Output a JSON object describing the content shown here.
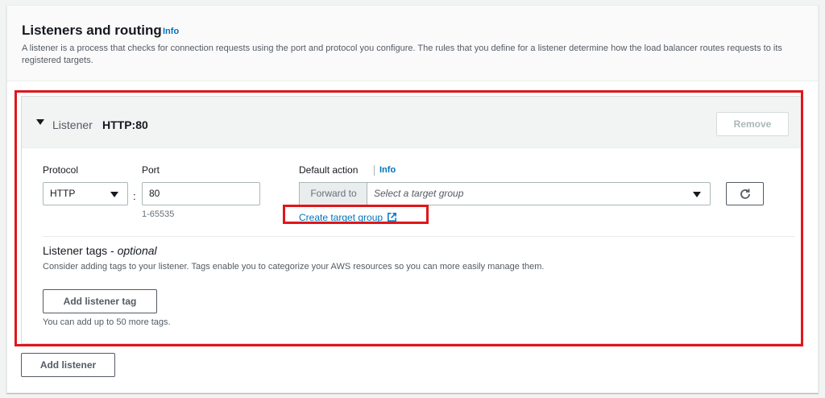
{
  "section": {
    "title": "Listeners and routing",
    "info_label": "Info",
    "description": "A listener is a process that checks for connection requests using the port and protocol you configure. The rules that you define for a listener determine how the load balancer routes requests to its registered targets."
  },
  "listener": {
    "label": "Listener",
    "name": "HTTP:80",
    "remove_label": "Remove",
    "protocol": {
      "label": "Protocol",
      "value": "HTTP"
    },
    "port": {
      "label": "Port",
      "value": "80",
      "hint": "1-65535"
    },
    "default_action": {
      "label": "Default action",
      "info_label": "Info",
      "addon": "Forward to",
      "placeholder": "Select a target group",
      "create_link": "Create target group"
    },
    "tags": {
      "title": "Listener tags - ",
      "title_optional": "optional",
      "description": "Consider adding tags to your listener. Tags enable you to categorize your AWS resources so you can more easily manage them.",
      "add_label": "Add listener tag",
      "limit_hint": "You can add up to 50 more tags."
    }
  },
  "add_listener_label": "Add listener",
  "icons": {
    "caret": "caret-down-icon",
    "select_arrow": "chevron-down-icon",
    "refresh": "refresh-icon",
    "external": "external-link-icon"
  },
  "colors": {
    "link": "#0073bb",
    "highlight": "#e0161b",
    "text": "#16191f",
    "muted": "#545b64"
  }
}
